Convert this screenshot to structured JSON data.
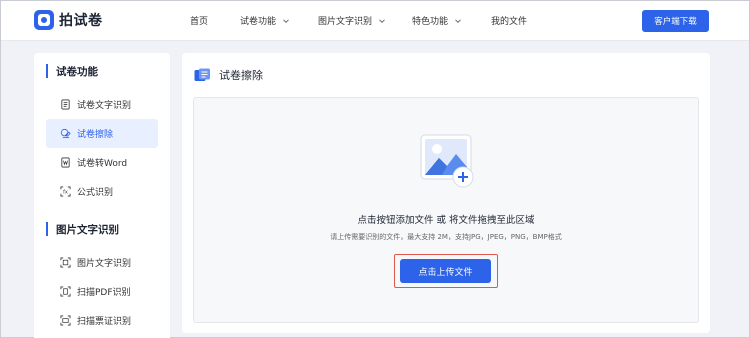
{
  "brand": {
    "name": "拍试卷"
  },
  "nav": [
    {
      "label": "首页",
      "has_dropdown": false
    },
    {
      "label": "试卷功能",
      "has_dropdown": true
    },
    {
      "label": "图片文字识别",
      "has_dropdown": true
    },
    {
      "label": "特色功能",
      "has_dropdown": true
    },
    {
      "label": "我的文件",
      "has_dropdown": false
    }
  ],
  "header": {
    "download_label": "客户端下载"
  },
  "sidebar": {
    "sections": [
      {
        "title": "试卷功能",
        "items": [
          {
            "label": "试卷文字识别",
            "icon": "doc-scan-icon",
            "active": false
          },
          {
            "label": "试卷擦除",
            "icon": "eraser-icon",
            "active": true
          },
          {
            "label": "试卷转Word",
            "icon": "word-doc-icon",
            "active": false
          },
          {
            "label": "公式识别",
            "icon": "formula-scan-icon",
            "active": false
          }
        ]
      },
      {
        "title": "图片文字识别",
        "items": [
          {
            "label": "图片文字识别",
            "icon": "image-text-icon",
            "active": false
          },
          {
            "label": "扫描PDF识别",
            "icon": "pdf-scan-icon",
            "active": false
          },
          {
            "label": "扫描票证识别",
            "icon": "ticket-scan-icon",
            "active": false
          }
        ]
      }
    ]
  },
  "main": {
    "title": "试卷擦除",
    "upload": {
      "main_text": "点击按钮添加文件 或 将文件拖拽至此区域",
      "sub_text": "请上传需要识别的文件，最大支持 2M，支持JPG，JPEG，PNG，BMP格式",
      "button_label": "点击上传文件"
    }
  },
  "colors": {
    "accent": "#2d63e8",
    "highlight_border": "#e2574c",
    "active_bg": "#e8efff"
  }
}
